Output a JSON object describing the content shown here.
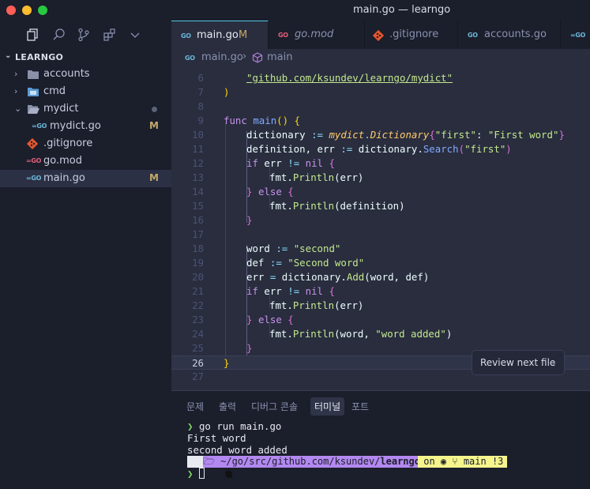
{
  "window": {
    "title": "main.go — learngo"
  },
  "sidebar": {
    "section": "LEARNGO",
    "items": [
      {
        "label": "accounts",
        "kind": "folder"
      },
      {
        "label": "cmd",
        "kind": "folder"
      },
      {
        "label": "mydict",
        "kind": "folder-open"
      },
      {
        "label": "mydict.go",
        "kind": "go",
        "badge": "M"
      },
      {
        "label": ".gitignore",
        "kind": "git"
      },
      {
        "label": "go.mod",
        "kind": "gomod"
      },
      {
        "label": "main.go",
        "kind": "go",
        "badge": "M"
      }
    ]
  },
  "tabs": [
    {
      "label": "main.go",
      "badge": "M",
      "icon": "GO"
    },
    {
      "label": "go.mod",
      "icon": "GO"
    },
    {
      "label": ".gitignore",
      "icon": "git-icon"
    },
    {
      "label": "accounts.go",
      "icon": "GO"
    }
  ],
  "breadcrumb": {
    "file": "main.go",
    "symbol": "main",
    "icon_text": "GO"
  },
  "editor": {
    "line_numbers": [
      "6",
      "7",
      "8",
      "9",
      "10",
      "11",
      "12",
      "13",
      "14",
      "15",
      "16",
      "17",
      "18",
      "19",
      "20",
      "21",
      "22",
      "23",
      "24",
      "25",
      "26",
      "27"
    ],
    "current_line": "26",
    "code_text": {
      "l6": "\"github.com/ksundev/learngo/mydict\"",
      "l7": ")",
      "l9a": "func",
      "l9b": "main",
      "l9c": "() {",
      "l10a": "dictionary",
      "l10b": ":=",
      "l10c": "mydict",
      "l10d": ".",
      "l10e": "Dictionary",
      "l10f": "{",
      "l10g": "\"first\"",
      "l10h": ": ",
      "l10i": "\"First word\"",
      "l10j": "}",
      "l11a": "definition, err",
      "l11b": ":=",
      "l11c": "dictionary.",
      "l11d": "Search",
      "l11e": "(",
      "l11f": "\"first\"",
      "l11g": ")",
      "l12a": "if",
      "l12b": "err",
      "l12c": "!=",
      "l12d": "nil",
      "l12e": "{",
      "l13a": "fmt.",
      "l13b": "Println",
      "l13c": "(err)",
      "l14a": "}",
      "l14b": "else",
      "l14c": "{",
      "l15a": "fmt.",
      "l15b": "Println",
      "l15c": "(definition)",
      "l16": "}",
      "l18a": "word",
      "l18b": ":=",
      "l18c": "\"second\"",
      "l19a": "def",
      "l19b": ":=",
      "l19c": "\"Second word\"",
      "l20a": "err",
      "l20b": "=",
      "l20c": "dictionary.",
      "l20d": "Add",
      "l20e": "(word, def)",
      "l21a": "if",
      "l21b": "err",
      "l21c": "!=",
      "l21d": "nil",
      "l21e": "{",
      "l22a": "fmt.",
      "l22b": "Println",
      "l22c": "(err)",
      "l23a": "}",
      "l23b": "else",
      "l23c": "{",
      "l24a": "fmt.",
      "l24b": "Println",
      "l24c": "(word, ",
      "l24d": "\"word added\"",
      "l24e": ")",
      "l25": "}",
      "l26": "}"
    },
    "review_button": {
      "label": "Review next file",
      "chevron": "›"
    }
  },
  "panel": {
    "tabs": [
      "문제",
      "출력",
      "디버그 콘솔",
      "터미널",
      "포트"
    ],
    "active_tab": "터미널",
    "terminal": {
      "prompt_symbol": "❯",
      "command": "go run main.go",
      "output": [
        "First word",
        "second word added"
      ],
      "powerline": {
        "os": "",
        "path_prefix": " ~/go/src/github.com/ksundev/",
        "path_bold": "learngo",
        "git_prefix": " on ",
        "git_branch": "main",
        "git_status": "!3"
      }
    }
  },
  "colors": {
    "accent": "#4ec9e0",
    "modified": "#c3a96a",
    "editor_bg": "#292d3e",
    "sidebar_bg": "#1b1e2b"
  }
}
